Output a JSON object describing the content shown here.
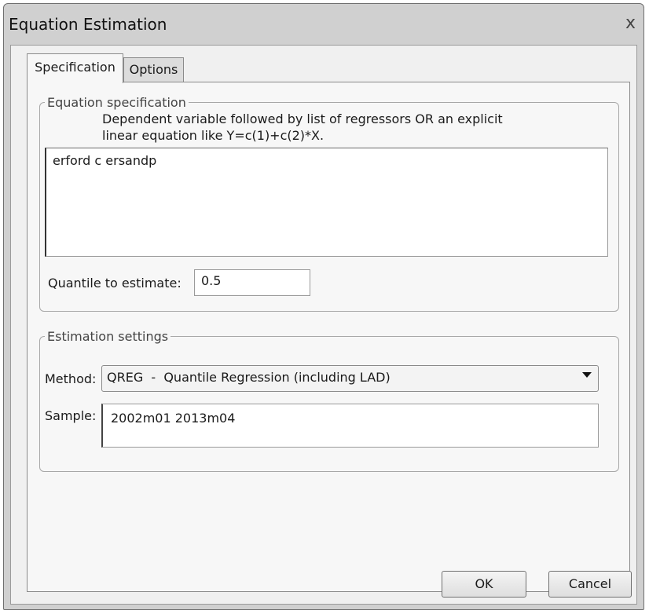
{
  "window": {
    "title": "Equation Estimation",
    "close_glyph": "x"
  },
  "tabs": [
    {
      "label": "Specification",
      "active": true
    },
    {
      "label": "Options",
      "active": false
    }
  ],
  "equation_spec": {
    "legend": "Equation specification",
    "help_line1": "Dependent variable followed by list of regressors OR an explicit",
    "help_line2": "linear equation like Y=c(1)+c(2)*X.",
    "equation_value": "erford c ersandp",
    "quantile_label": "Quantile to estimate:",
    "quantile_value": "0.5"
  },
  "estimation_settings": {
    "legend": "Estimation settings",
    "method_label": "Method:",
    "method_value": "QREG  -  Quantile Regression (including LAD)",
    "sample_label": "Sample:",
    "sample_value": "2002m01 2013m04"
  },
  "buttons": {
    "ok": "OK",
    "cancel": "Cancel"
  }
}
